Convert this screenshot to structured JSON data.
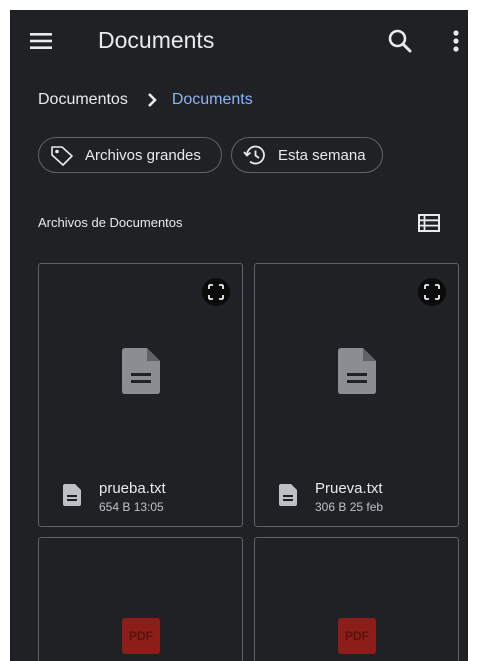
{
  "appbar": {
    "title": "Documents",
    "icons": [
      "hamburger-menu-icon",
      "search-icon",
      "more-vert-icon"
    ]
  },
  "breadcrumb": {
    "root": "Documentos",
    "current": "Documents"
  },
  "chips": [
    {
      "label": "Archivos grandes",
      "icon": "tag-icon"
    },
    {
      "label": "Esta semana",
      "icon": "history-icon"
    }
  ],
  "section": {
    "title": "Archivos de Documentos",
    "view_icon": "list-view-icon"
  },
  "files": [
    {
      "name": "prueba.txt",
      "meta": "654 B 13:05",
      "type": "text"
    },
    {
      "name": "Prueva.txt",
      "meta": "306 B 25 feb",
      "type": "text"
    },
    {
      "badge": "PDF",
      "type": "pdf"
    },
    {
      "badge": "PDF",
      "type": "pdf"
    }
  ],
  "colors": {
    "background": "#202124",
    "accent": "#8ab4f8",
    "pdf": "#8c1d18"
  }
}
